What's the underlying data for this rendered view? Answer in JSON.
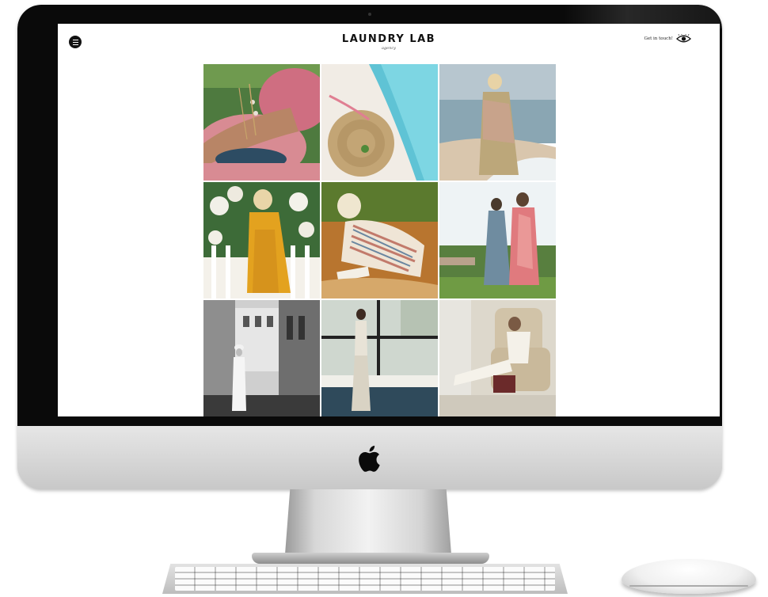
{
  "site": {
    "brand_name": "LAUNDRY LAB",
    "brand_tagline": "agency",
    "contact_label": "Get in touch!",
    "menu_icon": "hamburger-menu-icon",
    "contact_icon": "eye-icon"
  },
  "gallery": {
    "tiles": [
      {
        "subject": "bracelets-wrist"
      },
      {
        "subject": "straw-bag-pool"
      },
      {
        "subject": "beach-dress"
      },
      {
        "subject": "yellow-jacket-flowers"
      },
      {
        "subject": "striped-dress-grass"
      },
      {
        "subject": "two-women-robes"
      },
      {
        "subject": "street-bw"
      },
      {
        "subject": "window-figure"
      },
      {
        "subject": "chair-lounge"
      }
    ]
  },
  "colors": {
    "bezel": "#0a0a0a",
    "chin": "#d6d6d6",
    "screen_bg": "#ffffff",
    "text": "#111111"
  }
}
